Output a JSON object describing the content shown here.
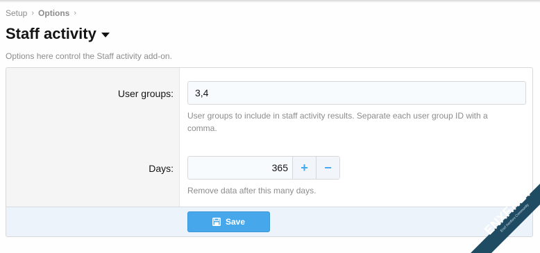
{
  "breadcrumb": {
    "items": [
      "Setup",
      "Options"
    ],
    "separator": "›"
  },
  "page": {
    "title": "Staff activity",
    "description": "Options here control the Staff activity add-on."
  },
  "form": {
    "user_groups": {
      "label": "User groups:",
      "value": "3,4",
      "hint_line1": "User groups to include in staff activity results. Separate each user group ID with a",
      "hint_line2": "comma."
    },
    "days": {
      "label": "Days:",
      "value": "365",
      "increment_symbol": "+",
      "decrement_symbol": "−",
      "hint": "Remove data after this many days."
    }
  },
  "footer": {
    "save_label": "Save",
    "save_icon": "save-icon"
  },
  "watermark": {
    "text": "ENXF.NET",
    "subtext": "Enxf Xenforo Community"
  },
  "colors": {
    "accent": "#47a7eb",
    "footer_bg": "#edf3fa",
    "watermark_bg": "#1f4b63",
    "watermark_text": "#ffffff"
  }
}
